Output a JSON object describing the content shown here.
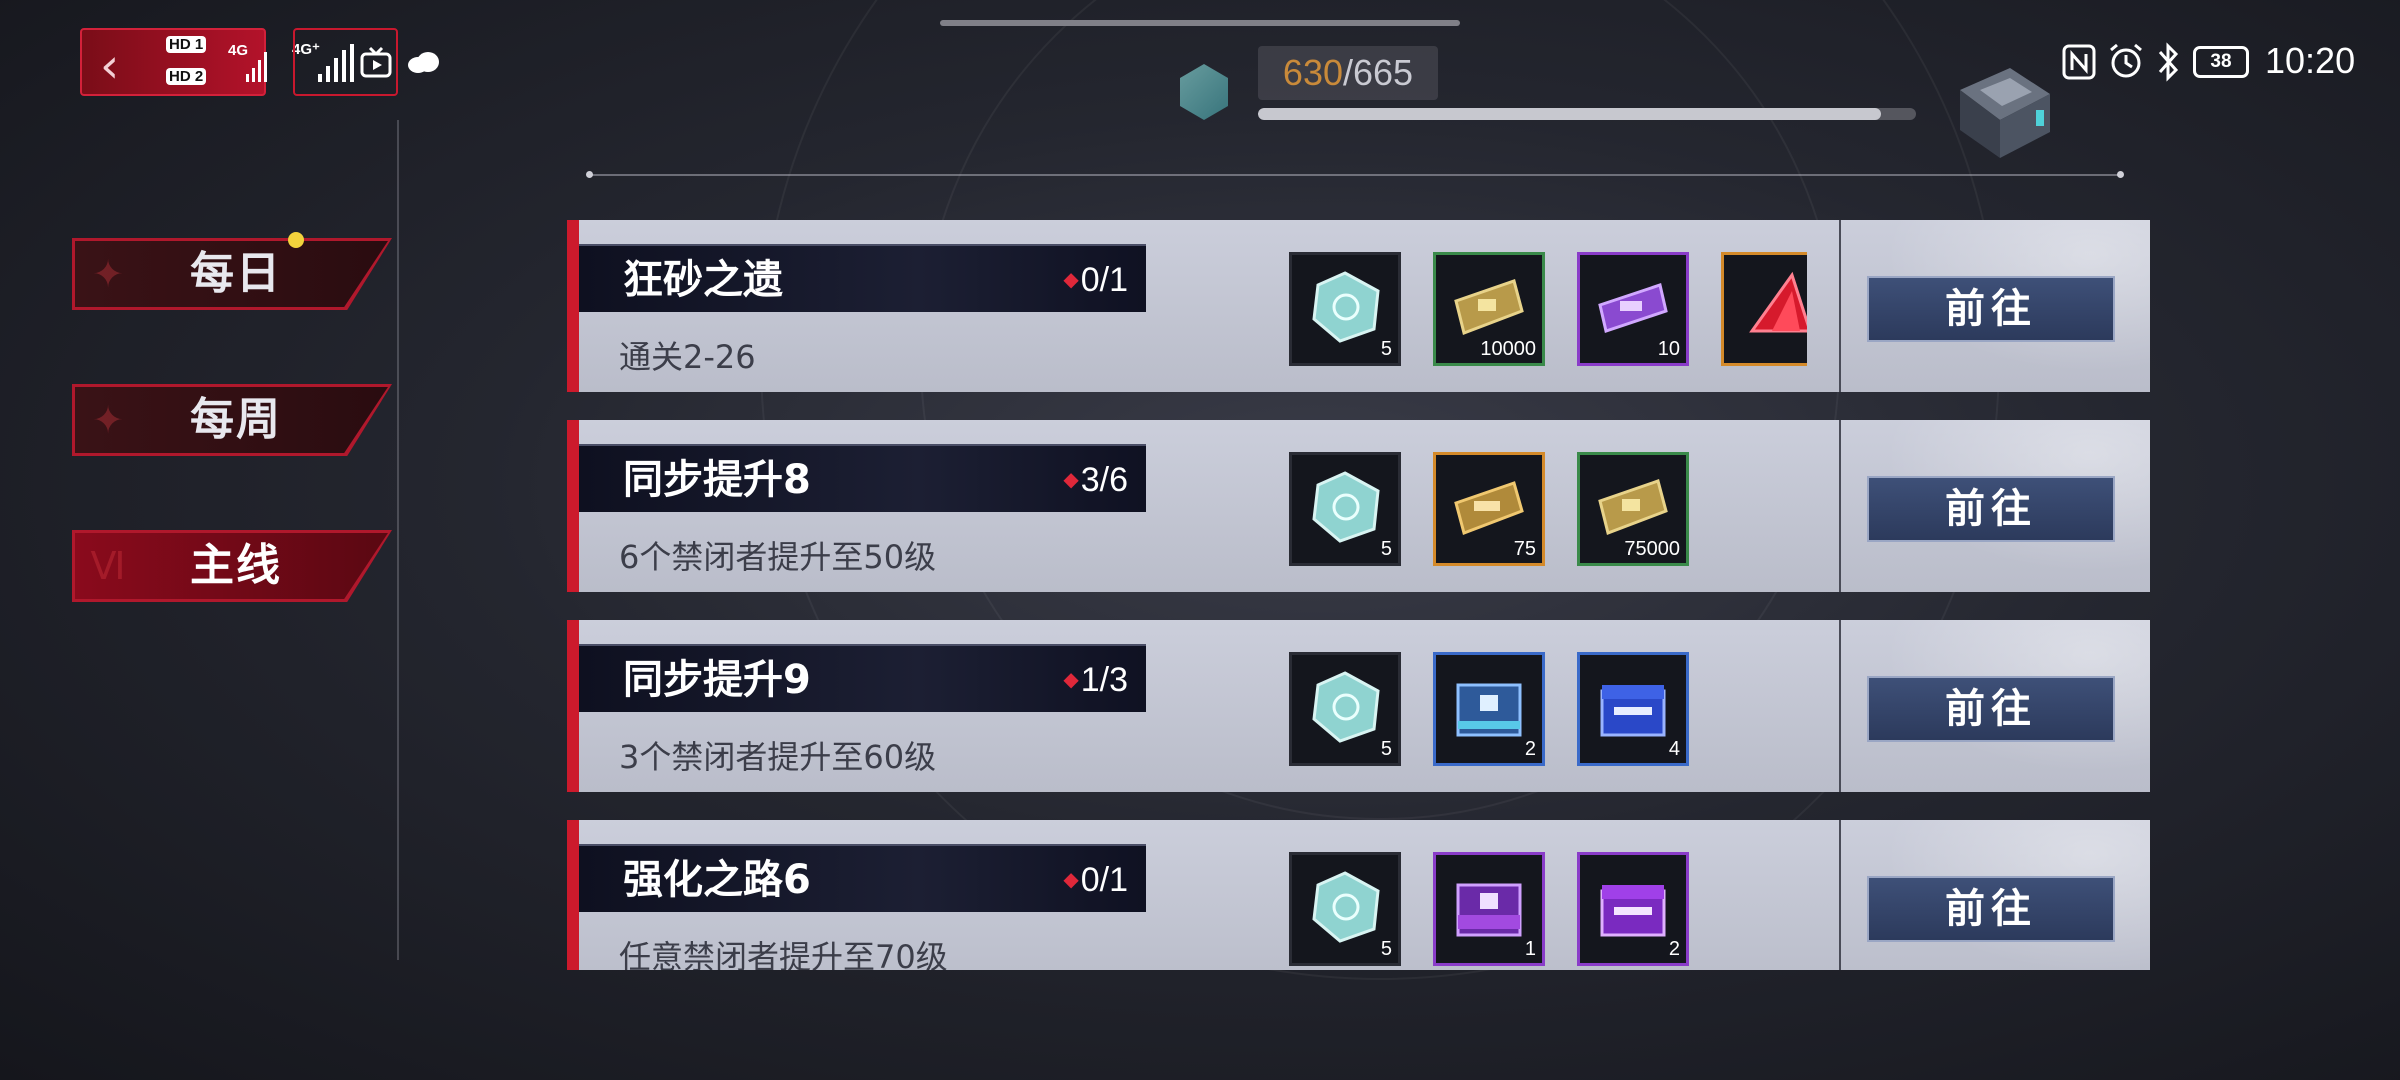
{
  "status_bar": {
    "sim1": "HD 1",
    "sim1_net": "4G",
    "sim2": "HD 2",
    "sim2_net": "4G⁺",
    "battery": "38",
    "time": "10:20"
  },
  "progress": {
    "current": "630",
    "max": "/665",
    "fill_fraction": 0.947
  },
  "nav": {
    "tabs": [
      {
        "label": "每日",
        "active": false,
        "has_notification": true
      },
      {
        "label": "每周",
        "active": false,
        "has_notification": false
      },
      {
        "label": "主线",
        "active": true,
        "has_notification": false
      }
    ]
  },
  "quests": [
    {
      "title": "狂砂之遗",
      "count": "0/1",
      "desc": "通关2-26",
      "button": "前往",
      "rewards": [
        {
          "icon": "crystal-icon",
          "rarity": "none",
          "qty": "5"
        },
        {
          "icon": "gold-ticket-icon",
          "rarity": "green",
          "qty": "10000"
        },
        {
          "icon": "purple-ticket-icon",
          "rarity": "purple",
          "qty": "10"
        },
        {
          "icon": "red-gem-icon",
          "rarity": "orange",
          "qty": ""
        }
      ]
    },
    {
      "title": "同步提升8",
      "count": "3/6",
      "desc": "6个禁闭者提升至50级",
      "button": "前往",
      "rewards": [
        {
          "icon": "crystal-icon",
          "rarity": "none",
          "qty": "5"
        },
        {
          "icon": "exp-card-icon",
          "rarity": "orange",
          "qty": "75"
        },
        {
          "icon": "gold-ticket-icon",
          "rarity": "green",
          "qty": "75000"
        }
      ]
    },
    {
      "title": "同步提升9",
      "count": "1/3",
      "desc": "3个禁闭者提升至60级",
      "button": "前往",
      "rewards": [
        {
          "icon": "crystal-icon",
          "rarity": "none",
          "qty": "5"
        },
        {
          "icon": "blue-box-icon",
          "rarity": "blue",
          "qty": "2"
        },
        {
          "icon": "blue-chest-icon",
          "rarity": "blue",
          "qty": "4"
        }
      ]
    },
    {
      "title": "强化之路6",
      "count": "0/1",
      "desc": "任意禁闭者提升至70级",
      "button": "前往",
      "rewards": [
        {
          "icon": "crystal-icon",
          "rarity": "none",
          "qty": "5"
        },
        {
          "icon": "purple-box-icon",
          "rarity": "purple",
          "qty": "1"
        },
        {
          "icon": "purple-chest-icon",
          "rarity": "purple",
          "qty": "2"
        }
      ]
    }
  ],
  "colors": {
    "accent_red": "#cc1a2c",
    "progress_current": "#c98a3a",
    "button_blue": "#2c3a5c"
  }
}
